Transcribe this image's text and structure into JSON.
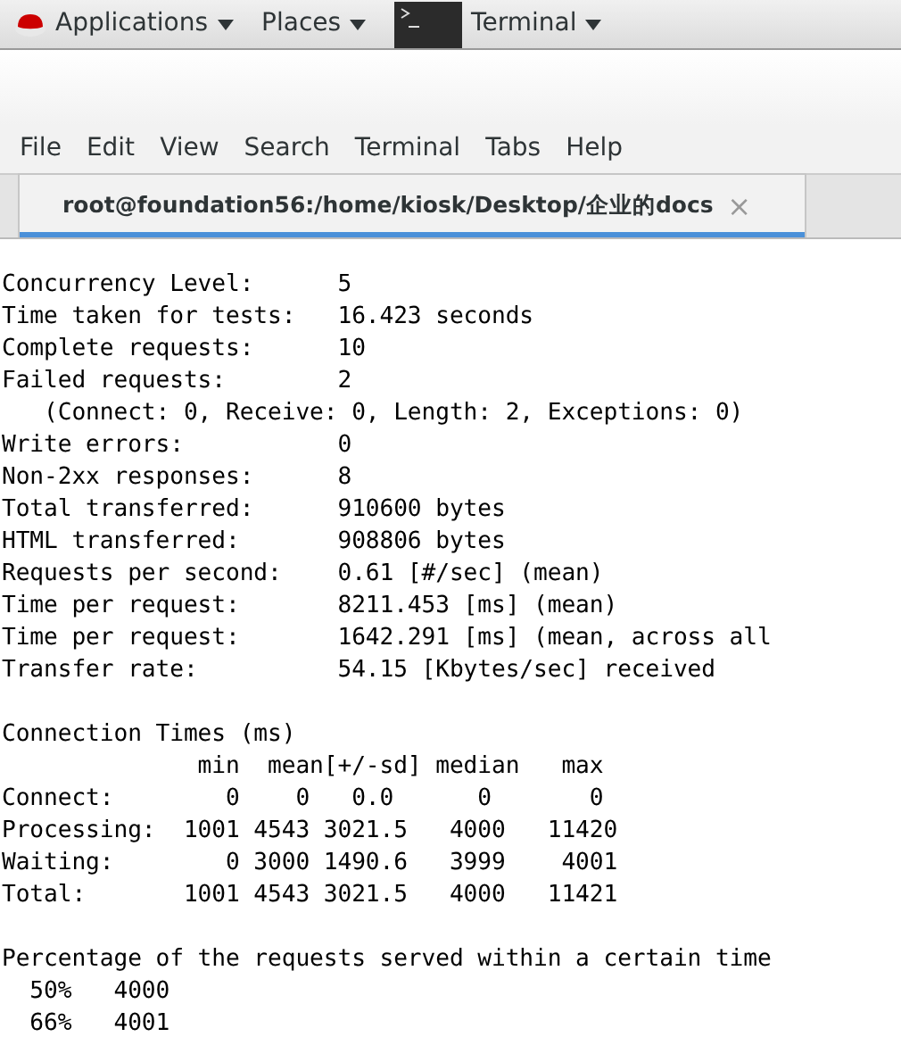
{
  "top_bar": {
    "menus": [
      {
        "label": "Applications",
        "kind": "logo"
      },
      {
        "label": "Places",
        "kind": "plain"
      },
      {
        "label": "Terminal",
        "kind": "app"
      }
    ]
  },
  "menu_bar": [
    "File",
    "Edit",
    "View",
    "Search",
    "Terminal",
    "Tabs",
    "Help"
  ],
  "tabs": [
    {
      "label": "root@foundation56:/home/kiosk/Desktop/企业的docs",
      "close": "×",
      "selected": true
    }
  ],
  "terminal": {
    "blocks": [
      [
        "Concurrency Level:      5",
        "Time taken for tests:   16.423 seconds",
        "Complete requests:      10",
        "Failed requests:        2",
        "   (Connect: 0, Receive: 0, Length: 2, Exceptions: 0)",
        "Write errors:           0",
        "Non-2xx responses:      8",
        "Total transferred:      910600 bytes",
        "HTML transferred:       908806 bytes",
        "Requests per second:    0.61 [#/sec] (mean)",
        "Time per request:       8211.453 [ms] (mean)",
        "Time per request:       1642.291 [ms] (mean, across all",
        "Transfer rate:          54.15 [Kbytes/sec] received"
      ],
      [
        "Connection Times (ms)",
        "              min  mean[+/-sd] median   max",
        "Connect:        0    0   0.0      0       0",
        "Processing:  1001 4543 3021.5   4000   11420",
        "Waiting:        0 3000 1490.6   3999    4001",
        "Total:       1001 4543 3021.5   4000   11421"
      ],
      [
        "Percentage of the requests served within a certain time",
        "  50%   4000",
        "  66%   4001"
      ]
    ]
  }
}
